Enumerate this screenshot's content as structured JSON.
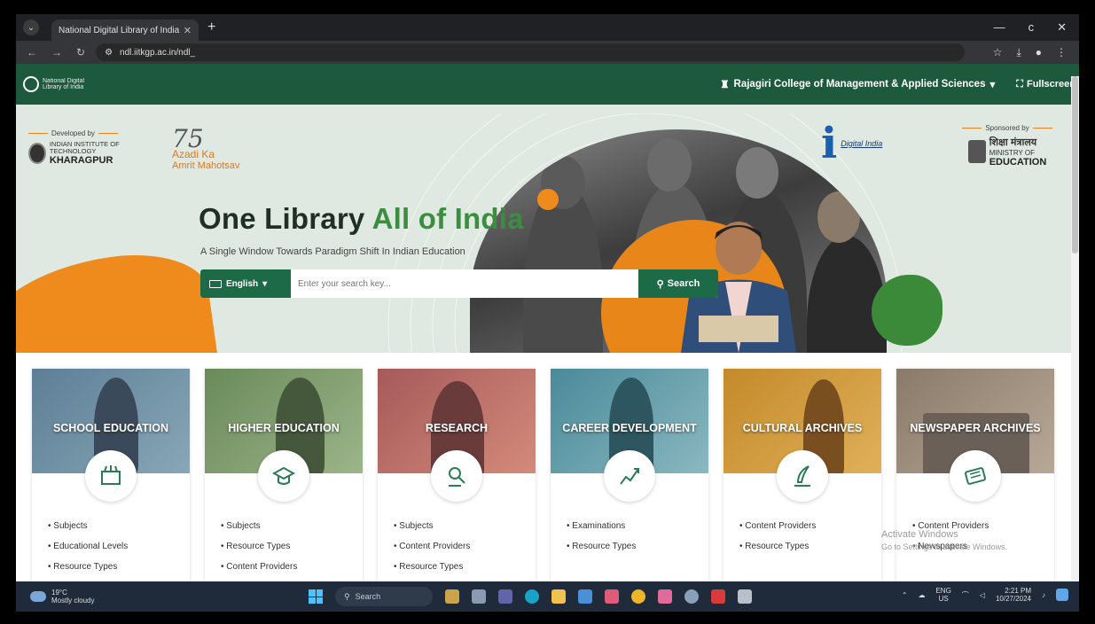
{
  "browser": {
    "tab_title": "National Digital Library of India",
    "tab_close": "✕",
    "new_tab": "+",
    "url": "ndl.iitkgp.ac.in/ndl_",
    "window_controls": [
      "—",
      "c",
      "✕"
    ]
  },
  "site": {
    "logo_text": "National Digital Library of India",
    "institution": "Rajagiri College of Management & Applied Sciences",
    "fullscreen_label": "Fullscreen",
    "developed_by": "Developed by",
    "iit_line1": "INDIAN INSTITUTE OF TECHNOLOGY",
    "iit_line2": "KHARAGPUR",
    "azadi_75": "75",
    "azadi_line1": "Azadi Ka",
    "azadi_line2": "Amrit Mahotsav",
    "digital_india": "Digital India",
    "sponsored_by": "Sponsored by",
    "ministry_hindi": "शिक्षा मंत्रालय",
    "ministry_line": "MINISTRY OF",
    "ministry_edu": "EDUCATION"
  },
  "hero": {
    "title_a": "One Library ",
    "title_b": "All of India",
    "subtitle": "A Single Window Towards Paradigm Shift In Indian Education",
    "language": "English",
    "search_placeholder": "Enter your search key...",
    "search_button": "Search"
  },
  "cards": [
    {
      "title": "SCHOOL EDUCATION",
      "icon": "school-icon",
      "links": [
        "Subjects",
        "Educational Levels",
        "Resource Types"
      ]
    },
    {
      "title": "HIGHER EDUCATION",
      "icon": "graduation-icon",
      "links": [
        "Subjects",
        "Resource Types",
        "Content Providers"
      ]
    },
    {
      "title": "RESEARCH",
      "icon": "research-icon",
      "links": [
        "Subjects",
        "Content Providers",
        "Resource Types"
      ]
    },
    {
      "title": "CAREER DEVELOPMENT",
      "icon": "career-icon",
      "links": [
        "Examinations",
        "Resource Types"
      ]
    },
    {
      "title": "CULTURAL ARCHIVES",
      "icon": "quill-icon",
      "links": [
        "Content Providers",
        "Resource Types"
      ]
    },
    {
      "title": "NEWSPAPER ARCHIVES",
      "icon": "newspaper-icon",
      "links": [
        "Content Providers",
        "Newspapers"
      ]
    }
  ],
  "watermark": {
    "line1": "Activate Windows",
    "line2": "Go to Settings to activate Windows."
  },
  "taskbar": {
    "weather_temp": "19°C",
    "weather_desc": "Mostly cloudy",
    "search_label": "Search",
    "lang": "ENG",
    "region": "US",
    "time": "2:21 PM",
    "date": "10/27/2024"
  },
  "colors": {
    "brand_green": "#1d6b46",
    "accent_orange": "#ef8a1c",
    "header_green": "#1d5a3d"
  }
}
